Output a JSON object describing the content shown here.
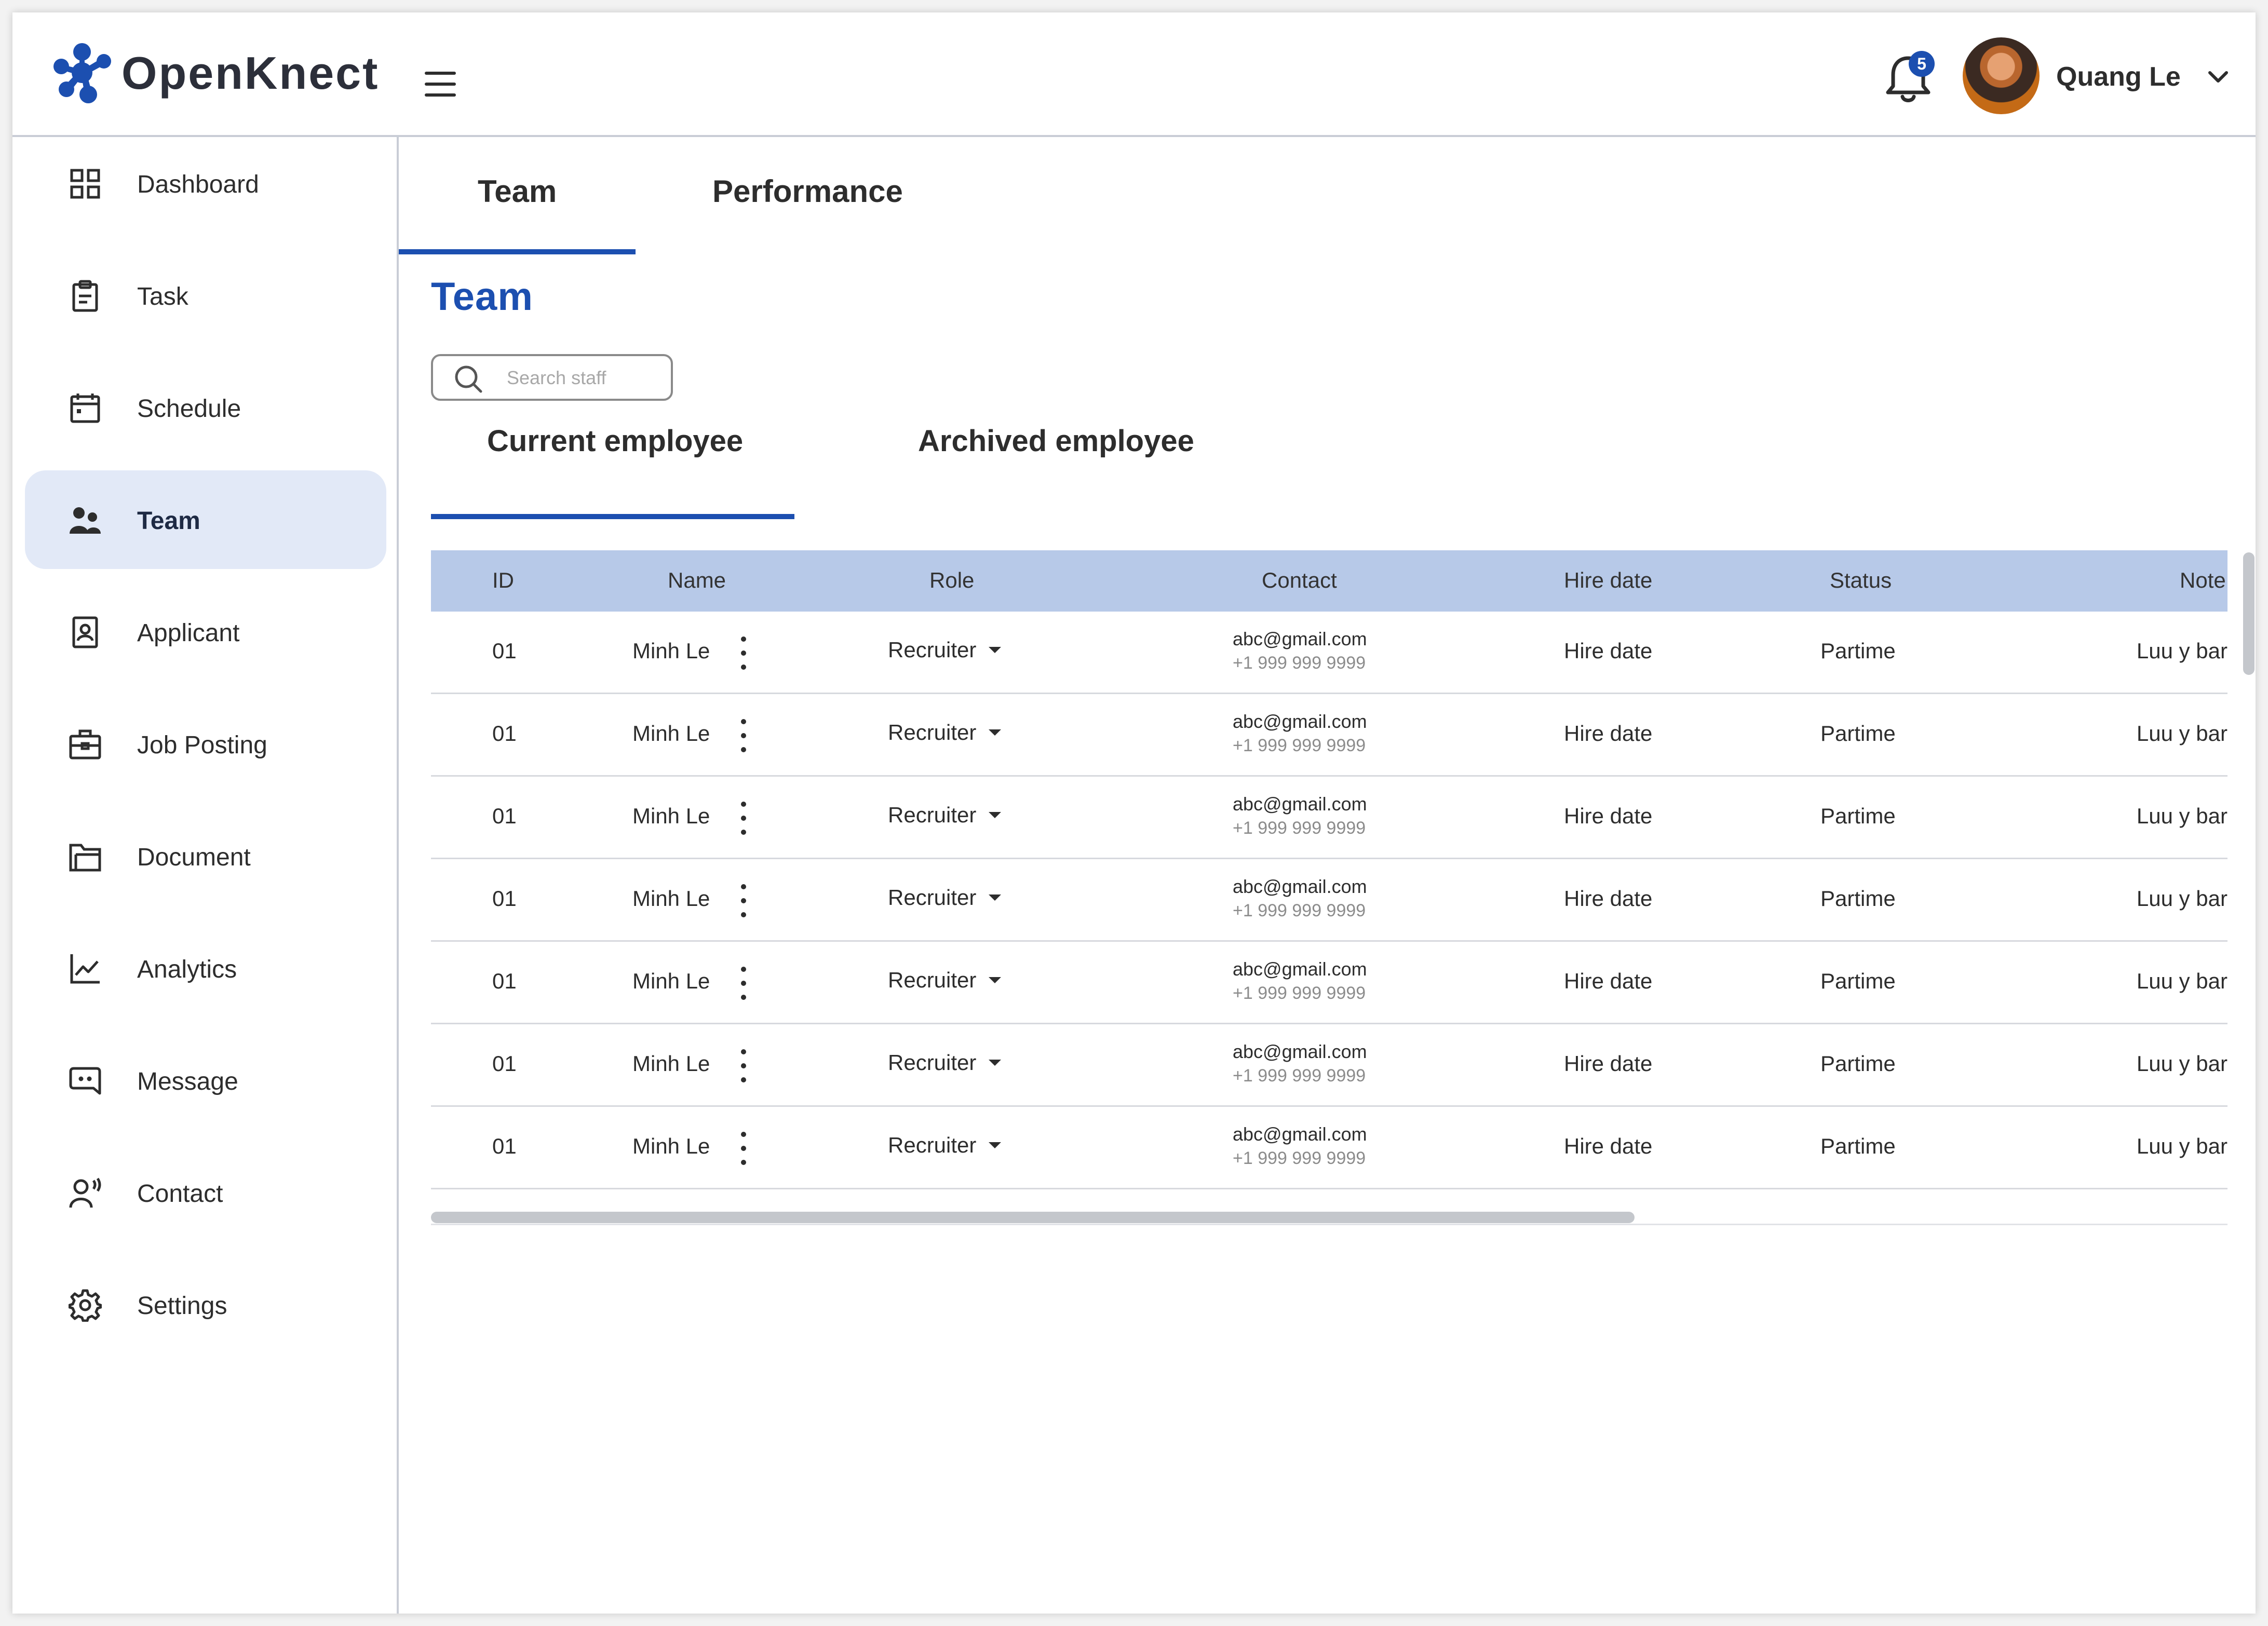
{
  "brand": {
    "name": "OpenKnect",
    "color": "#1c4fb0"
  },
  "header": {
    "notification_count": "5",
    "user_name": "Quang Le"
  },
  "sidebar": {
    "items": [
      {
        "label": "Dashboard",
        "icon": "dashboard-icon"
      },
      {
        "label": "Task",
        "icon": "clipboard-icon"
      },
      {
        "label": "Schedule",
        "icon": "calendar-icon"
      },
      {
        "label": "Team",
        "icon": "team-icon",
        "active": true
      },
      {
        "label": "Applicant",
        "icon": "applicant-icon"
      },
      {
        "label": "Job Posting",
        "icon": "briefcase-icon"
      },
      {
        "label": "Document",
        "icon": "folder-icon"
      },
      {
        "label": "Analytics",
        "icon": "analytics-icon"
      },
      {
        "label": "Message",
        "icon": "message-icon"
      },
      {
        "label": "Contact",
        "icon": "contact-icon"
      },
      {
        "label": "Settings",
        "icon": "gear-icon"
      }
    ]
  },
  "main": {
    "tabs": [
      "Team",
      "Performance"
    ],
    "active_tab": "Team",
    "title": "Team",
    "search_placeholder": "Search staff",
    "sub_tabs": [
      "Current employee",
      "Archived employee"
    ],
    "active_sub_tab": "Current employee",
    "columns": [
      "ID",
      "Name",
      "Role",
      "Contact",
      "Hire date",
      "Status",
      "Note"
    ],
    "rows": [
      {
        "id": "01",
        "name": "Minh Le",
        "role": "Recruiter",
        "email": "abc@gmail.com",
        "phone": "+1 999 999 9999",
        "hire_date": "Hire date",
        "status": "Partime",
        "note": "Luu y bar"
      },
      {
        "id": "01",
        "name": "Minh Le",
        "role": "Recruiter",
        "email": "abc@gmail.com",
        "phone": "+1 999 999 9999",
        "hire_date": "Hire date",
        "status": "Partime",
        "note": "Luu y bar"
      },
      {
        "id": "01",
        "name": "Minh Le",
        "role": "Recruiter",
        "email": "abc@gmail.com",
        "phone": "+1 999 999 9999",
        "hire_date": "Hire date",
        "status": "Partime",
        "note": "Luu y bar"
      },
      {
        "id": "01",
        "name": "Minh Le",
        "role": "Recruiter",
        "email": "abc@gmail.com",
        "phone": "+1 999 999 9999",
        "hire_date": "Hire date",
        "status": "Partime",
        "note": "Luu y bar"
      },
      {
        "id": "01",
        "name": "Minh Le",
        "role": "Recruiter",
        "email": "abc@gmail.com",
        "phone": "+1 999 999 9999",
        "hire_date": "Hire date",
        "status": "Partime",
        "note": "Luu y bar"
      },
      {
        "id": "01",
        "name": "Minh Le",
        "role": "Recruiter",
        "email": "abc@gmail.com",
        "phone": "+1 999 999 9999",
        "hire_date": "Hire date",
        "status": "Partime",
        "note": "Luu y bar"
      },
      {
        "id": "01",
        "name": "Minh Le",
        "role": "Recruiter",
        "email": "abc@gmail.com",
        "phone": "+1 999 999 9999",
        "hire_date": "Hire date",
        "status": "Partime",
        "note": "Luu y bar"
      }
    ]
  },
  "colors": {
    "accent": "#1c4fb0",
    "table_header": "#b7c9e8",
    "active_nav": "#e2e9f7"
  }
}
